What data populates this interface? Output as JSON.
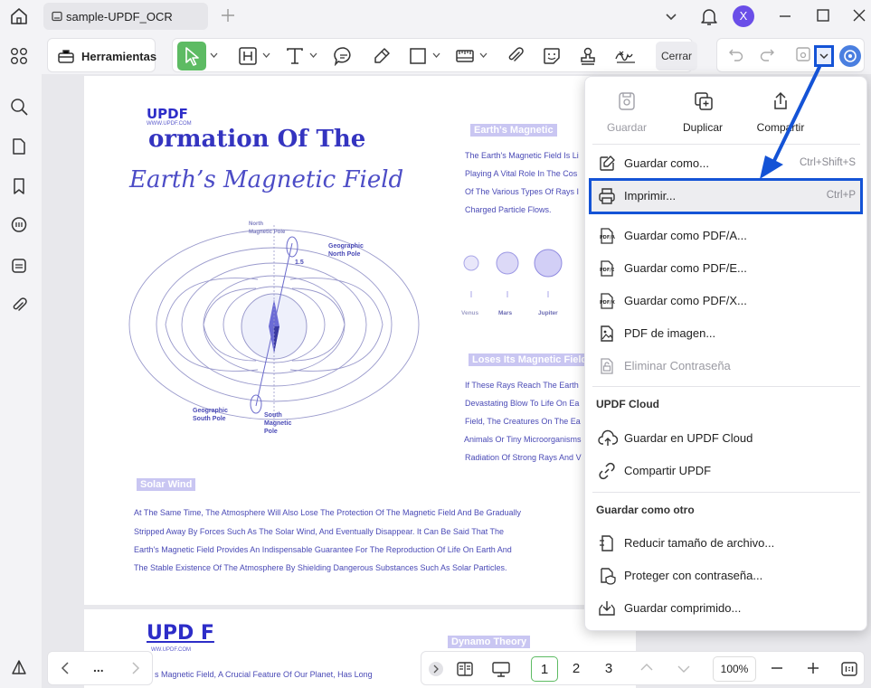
{
  "window": {
    "tab_title": "sample-UPDF_OCR",
    "avatar_letter": "X"
  },
  "toolbar": {
    "tools_label": "Herramientas",
    "close_label": "Cerrar"
  },
  "menu": {
    "top_actions": [
      {
        "label": "Guardar",
        "icon": "save-icon",
        "enabled": false
      },
      {
        "label": "Duplicar",
        "icon": "duplicate-icon",
        "enabled": true
      },
      {
        "label": "Compartir",
        "icon": "share-icon",
        "enabled": true
      }
    ],
    "items": [
      {
        "label": "Guardar como...",
        "shortcut": "Ctrl+Shift+S",
        "icon": "save-as-icon"
      },
      {
        "label": "Imprimir...",
        "shortcut": "Ctrl+P",
        "icon": "printer-icon",
        "highlighted": true
      },
      {
        "label": "Guardar como PDF/A...",
        "icon": "pdfa-icon"
      },
      {
        "label": "Guardar como PDF/E...",
        "icon": "pdfe-icon"
      },
      {
        "label": "Guardar como PDF/X...",
        "icon": "pdfx-icon"
      },
      {
        "label": "PDF de imagen...",
        "icon": "image-pdf-icon"
      },
      {
        "label": "Eliminar Contraseña",
        "icon": "remove-password-icon",
        "enabled": false
      }
    ],
    "cloud_section": "UPDF Cloud",
    "cloud_items": [
      {
        "label": "Guardar en UPDF Cloud",
        "icon": "cloud-upload-icon"
      },
      {
        "label": "Compartir UPDF",
        "icon": "link-icon"
      }
    ],
    "other_section": "Guardar como otro",
    "other_items": [
      {
        "label": "Reducir tamaño de archivo...",
        "icon": "compress-icon"
      },
      {
        "label": "Proteger con contraseña...",
        "icon": "shield-icon"
      },
      {
        "label": "Guardar comprimido...",
        "icon": "archive-icon"
      }
    ]
  },
  "document": {
    "logo": "UPDF",
    "logo_url": "WWW.UPDF.COM",
    "hero_line1": "ormation Of The",
    "hero_line2": "Earth’s Magnetic Field",
    "diagram_labels": {
      "north_magnetic": "North\nMagnetic Pole",
      "geo_north": "Geographic\nNorth Pole",
      "angle": "1.5",
      "geo_south": "Geographic\nSouth Pole",
      "south_magnetic": "South\nMagnetic\nPole"
    },
    "section_magnetic": "Earth's Magnetic",
    "magnetic_lines": [
      "The Earth's Magnetic Field Is Li",
      "Playing A Vital Role In The Cos",
      "Of The Various Types Of Rays I",
      "Charged Particle Flows."
    ],
    "planets": [
      "Venus",
      "Mars",
      "Jupiter"
    ],
    "section_loses": "Loses Its Magnetic Field",
    "loses_lines": [
      "If These Rays Reach The Earth",
      "Devastating Blow To Life On Ea",
      "Field, The Creatures On The Ea",
      "Animals Or Tiny Microorganisms",
      "Radiation Of Strong Rays And V"
    ],
    "section_solar": "Solar Wind",
    "solar_lines": [
      "At The Same Time, The Atmosphere Will Also Lose The Protection Of The Magnetic Field And Be Gradually",
      "Stripped Away By Forces Such As The Solar Wind, And Eventually Disappear. It Can Be Said That The",
      "Earth's Magnetic Field Provides An Indispensable Guarantee For The Reproduction Of Life On Earth And",
      "The Stable Existence Of The Atmosphere By Shielding Dangerous Substances Such As Solar Particles."
    ],
    "page2_logo": "UPD F",
    "page2_logo_url": "WW.UPDF.COM",
    "page2_section": "Dynamo Theory",
    "page2_line": "s Magnetic Field, A Crucial Feature Of Our Planet, Has Long"
  },
  "bottom": {
    "more": "...",
    "pages": [
      "1",
      "2",
      "3"
    ],
    "current_page": "1",
    "zoom": "100%"
  },
  "colors": {
    "accent_green": "#5dbb63",
    "highlight_blue": "#1453d6",
    "doc_text": "#4a4ab6"
  }
}
